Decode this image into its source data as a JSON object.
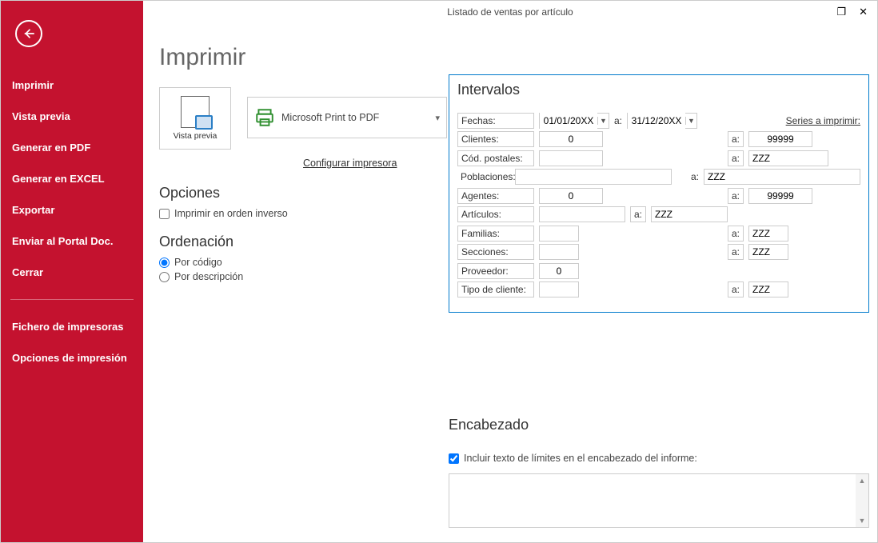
{
  "window": {
    "title": "Listado de ventas por artículo"
  },
  "sidebar": {
    "items": [
      "Imprimir",
      "Vista previa",
      "Generar en PDF",
      "Generar en EXCEL",
      "Exportar",
      "Enviar al Portal Doc.",
      "Cerrar"
    ],
    "items2": [
      "Fichero de impresoras",
      "Opciones de impresión"
    ]
  },
  "main": {
    "heading": "Imprimir",
    "preview_label": "Vista previa",
    "printer_name": "Microsoft Print to PDF",
    "config_printer": "Configurar impresora",
    "opciones_heading": "Opciones",
    "reverse_label": "Imprimir en orden inverso",
    "orden_heading": "Ordenación",
    "radio_codigo": "Por código",
    "radio_desc": "Por descripción"
  },
  "intervalos": {
    "heading": "Intervalos",
    "fechas_label": "Fechas:",
    "fecha_desde": "01/01/20XX",
    "fecha_hasta": "31/12/20XX",
    "a": "a:",
    "series_link": "Series a imprimir:",
    "clientes_label": "Clientes:",
    "clientes_desde": "0",
    "clientes_hasta": "99999",
    "codpost_label": "Cód. postales:",
    "codpost_desde": "",
    "codpost_hasta": "ZZZ",
    "poblaciones_label": "Poblaciones:",
    "poblaciones_desde": "",
    "poblaciones_hasta": "ZZZ",
    "agentes_label": "Agentes:",
    "agentes_desde": "0",
    "agentes_hasta": "99999",
    "articulos_label": "Artículos:",
    "articulos_desde": "",
    "articulos_hasta": "ZZZ",
    "familias_label": "Familias:",
    "familias_desde": "",
    "familias_hasta": "ZZZ",
    "secciones_label": "Secciones:",
    "secciones_desde": "",
    "secciones_hasta": "ZZZ",
    "proveedor_label": "Proveedor:",
    "proveedor_desde": "0",
    "tipocliente_label": "Tipo de cliente:",
    "tipocliente_desde": "",
    "tipocliente_hasta": "ZZZ"
  },
  "encabezado": {
    "heading": "Encabezado",
    "check_label": "Incluir texto de límites en el encabezado del informe:"
  }
}
